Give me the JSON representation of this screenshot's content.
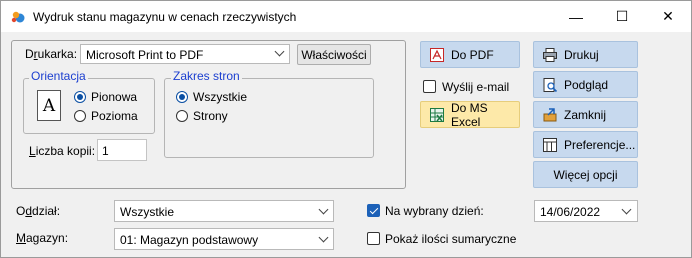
{
  "window": {
    "title": "Wydruk stanu magazynu w cenach rzeczywistych",
    "minimize": "—",
    "maximize": "☐",
    "close": "✕"
  },
  "printer": {
    "label_pre": "D",
    "label_ul": "r",
    "label_post": "ukarka:",
    "value": "Microsoft Print to PDF",
    "properties_btn": "Właściwości"
  },
  "orientation": {
    "legend": "Orientacja",
    "icon_glyph": "A",
    "options": [
      "Pionowa",
      "Pozioma"
    ],
    "selected": "Pionowa"
  },
  "page_range": {
    "legend": "Zakres stron",
    "options": [
      "Wszystkie",
      "Strony"
    ],
    "selected": "Wszystkie"
  },
  "copies": {
    "label_ul": "L",
    "label_post": "iczba kopii:",
    "value": "1"
  },
  "actions": {
    "pdf": "Do PDF",
    "email": "Wyślij e-mail",
    "excel": "Do MS Excel",
    "print": "Drukuj",
    "preview": "Podgląd",
    "close": "Zamknij",
    "prefs": "Preferencje...",
    "more": "Więcej opcji"
  },
  "filters": {
    "branch_label_pre": "O",
    "branch_label_ul": "d",
    "branch_label_post": "dział:",
    "branch_value": "Wszystkie",
    "warehouse_label_ul": "M",
    "warehouse_label_post": "agazyn:",
    "warehouse_value": "01: Magazyn podstawowy",
    "on_day_label": "Na wybrany dzień:",
    "on_day_checked": true,
    "date_value": "14/06/2022",
    "summary_label": "Pokaż ilości sumaryczne",
    "summary_checked": false
  },
  "colors": {
    "accent": "#0a4fa3",
    "legend_blue": "#1c3fd0",
    "action_blue": "#c7d9ee",
    "highlight_yellow": "#fde9a9"
  }
}
